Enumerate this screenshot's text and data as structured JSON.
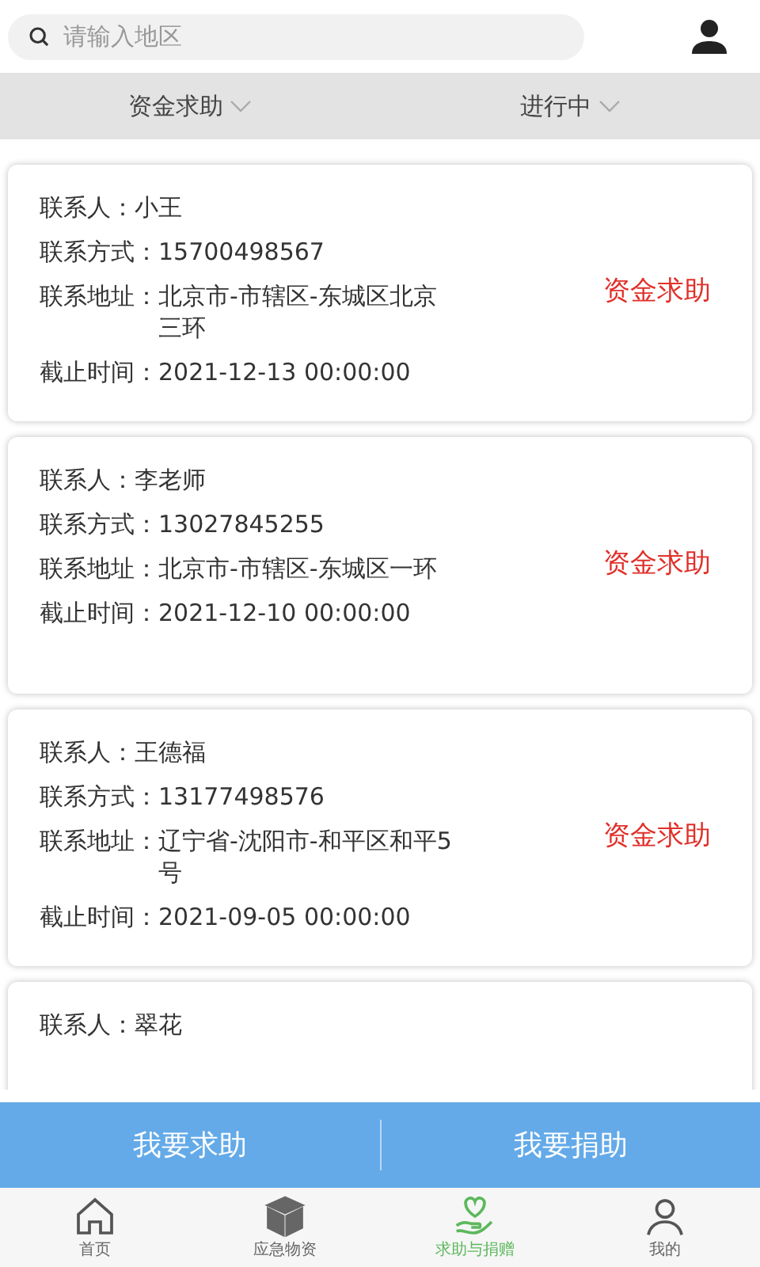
{
  "search": {
    "placeholder": "请输入地区"
  },
  "filters": [
    {
      "label": "资金求助"
    },
    {
      "label": "进行中"
    }
  ],
  "cards": [
    {
      "lines": [
        {
          "label": "联系人：",
          "value": "小王"
        },
        {
          "label": "联系方式：",
          "value": "15700498567"
        },
        {
          "label": "联系地址：",
          "value": "北京市-市辖区-东城区北京三环"
        },
        {
          "label": "截止时间：",
          "value": "2021-12-13 00:00:00"
        }
      ],
      "type": "资金求助"
    },
    {
      "lines": [
        {
          "label": "联系人：",
          "value": "李老师"
        },
        {
          "label": "联系方式：",
          "value": "13027845255"
        },
        {
          "label": "联系地址：",
          "value": "北京市-市辖区-东城区一环"
        },
        {
          "label": "截止时间：",
          "value": "2021-12-10 00:00:00"
        }
      ],
      "type": "资金求助"
    },
    {
      "lines": [
        {
          "label": "联系人：",
          "value": "王德福"
        },
        {
          "label": "联系方式：",
          "value": "13177498576"
        },
        {
          "label": "联系地址：",
          "value": "辽宁省-沈阳市-和平区和平5号"
        },
        {
          "label": "截止时间：",
          "value": "2021-09-05 00:00:00"
        }
      ],
      "type": "资金求助"
    },
    {
      "lines": [
        {
          "label": "联系人：",
          "value": "翠花"
        }
      ]
    }
  ],
  "actions": [
    "我要求助",
    "我要捐助"
  ],
  "tabs": [
    {
      "label": "首页",
      "kind": "home",
      "selected": false
    },
    {
      "label": "应急物资",
      "kind": "box",
      "selected": false
    },
    {
      "label": "求助与捐赠",
      "kind": "heart",
      "selected": true
    },
    {
      "label": "我的",
      "kind": "user",
      "selected": false
    }
  ]
}
